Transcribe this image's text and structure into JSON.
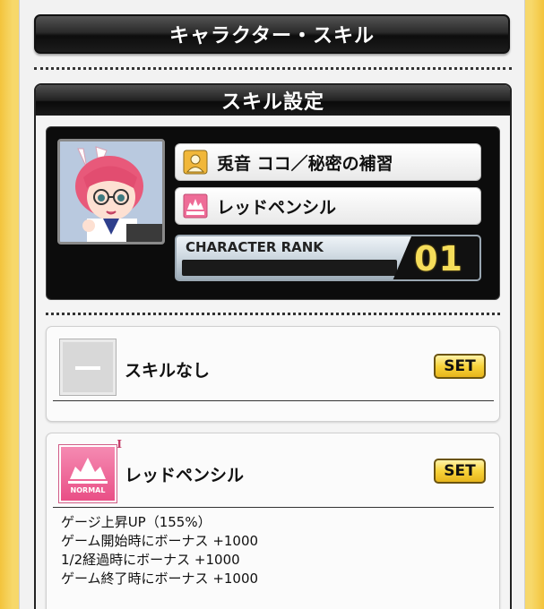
{
  "header": {
    "title": "キャラクター・スキル"
  },
  "section": {
    "title": "スキル設定"
  },
  "character": {
    "name": "兎音 ココ／秘密の補習",
    "equipped_skill": "レッドペンシル",
    "rank_label": "CHARACTER RANK",
    "rank_value": "01"
  },
  "skills": [
    {
      "name": "スキルなし",
      "set_label": "SET",
      "icon": "empty-skill-icon"
    },
    {
      "name": "レッドペンシル",
      "set_label": "SET",
      "icon": "normal-skill-icon",
      "badge_text": "NORMAL",
      "level_mark": "I",
      "description": [
        "ゲージ上昇UP（155%）",
        "ゲーム開始時にボーナス +1000",
        "1/2経過時にボーナス +1000",
        "ゲーム終了時にボーナス +1000"
      ]
    }
  ],
  "colors": {
    "gold_frame": "#f3c43c",
    "set_button": "#f8d33a",
    "normal_badge": "#e94f86",
    "rank_number": "#f5dd5a"
  }
}
